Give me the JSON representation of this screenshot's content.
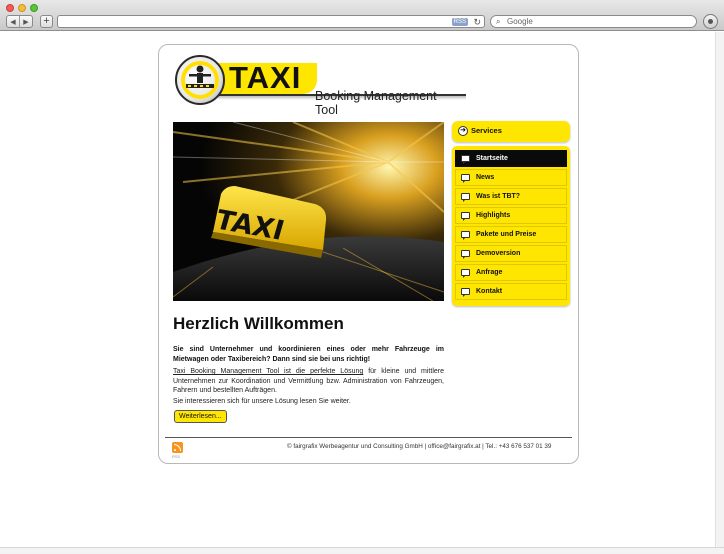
{
  "browser": {
    "rss_badge": "RSS",
    "search_placeholder": "Google"
  },
  "logo": {
    "title": "TAXI",
    "subtitle": "Booking Management Tool"
  },
  "hero": {
    "sign_text": "TAXI"
  },
  "content": {
    "heading": "Herzlich Willkommen",
    "intro": "Sie sind Unternehmer und koordinieren eines oder mehr Fahrzeuge im Mietwagen oder Taxibereich? Dann sind sie bei uns richtig!",
    "para_link": "Taxi Booking Management Tool ist die perfekte Lösung",
    "para_rest": " für kleine und mittlere Unternehmen zur Koordination und Vermittlung bzw. Administration von Fahrzeugen, Fahrern und bestellten Aufträgen.",
    "para2": "Sie interessieren sich für unsere Lösung lesen Sie weiter.",
    "more_button": "Weiterlesen..."
  },
  "sidebar": {
    "header": "Services",
    "items": [
      {
        "label": "Startseite",
        "active": true
      },
      {
        "label": "News"
      },
      {
        "label": "Was ist TBT?"
      },
      {
        "label": "Highlights"
      },
      {
        "label": "Pakete und Preise"
      },
      {
        "label": "Demoversion"
      },
      {
        "label": "Anfrage"
      },
      {
        "label": "Kontakt"
      }
    ]
  },
  "footer": {
    "rss_caption": "RSS",
    "text": "© fairgrafix Werbeagentur und Consulting GmbH | office@fairgrafix.at | Tel.: +43 676 537 01 39"
  },
  "colors": {
    "brand_yellow": "#ffe600",
    "active_menu": "#0a0a0a"
  }
}
